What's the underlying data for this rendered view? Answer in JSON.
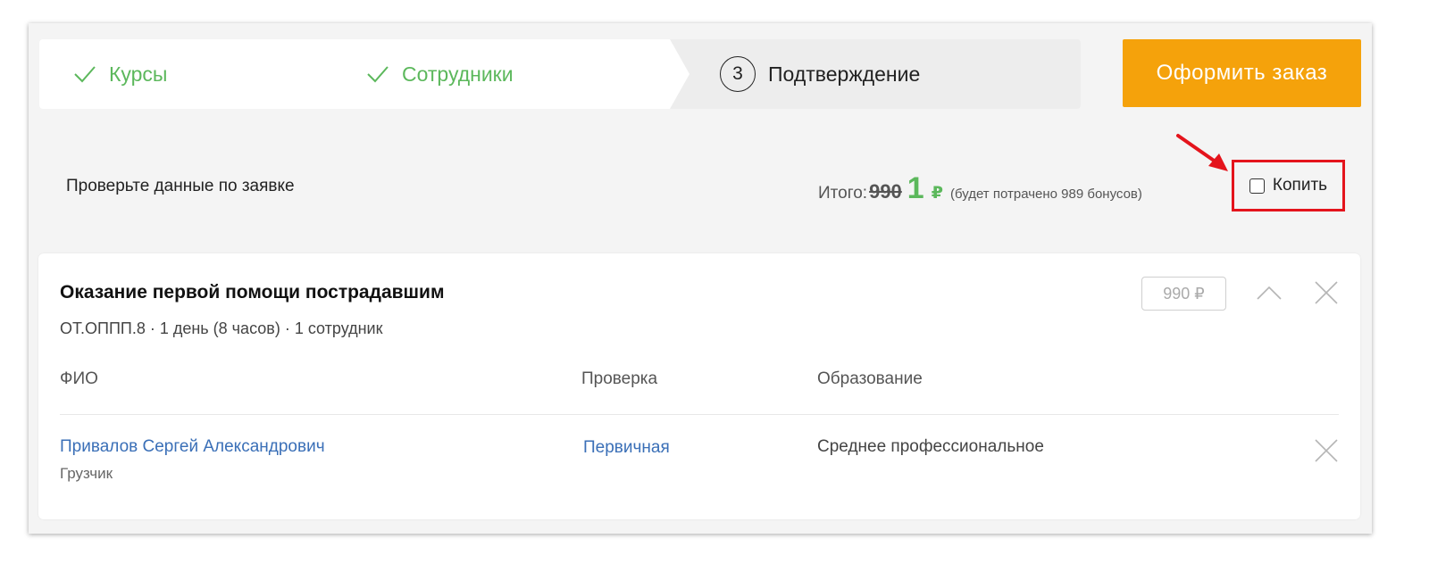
{
  "stepper": {
    "steps": [
      {
        "label": "Курсы",
        "status": "done",
        "icon": "check-icon"
      },
      {
        "label": "Сотрудники",
        "status": "done",
        "icon": "check-icon"
      },
      {
        "number": "3",
        "label": "Подтверждение",
        "status": "current"
      }
    ],
    "done_color": "#5cb85c"
  },
  "order_button": {
    "label": "Оформить заказ",
    "color": "#f5a20b"
  },
  "summary": {
    "check_label": "Проверьте данные по заявке",
    "total_label": "Итого:",
    "old_price": "990",
    "new_price": "1",
    "currency": "₽",
    "bonus_note": "(будет потрачено 989 бонусов)",
    "accumulate_label": "Копить",
    "accumulate_checked": false,
    "highlight_color": "#e4141c"
  },
  "course": {
    "title": "Оказание первой помощи пострадавшим",
    "meta": "ОТ.ОППП.8 · 1 день (8 часов) · 1 сотрудник",
    "price": "990 ₽",
    "columns": [
      "ФИО",
      "Проверка",
      "Образование"
    ],
    "employees": [
      {
        "name": "Привалов Сергей Александрович",
        "role": "Грузчик",
        "check": "Первичная",
        "education": "Среднее профессиональное"
      }
    ]
  }
}
